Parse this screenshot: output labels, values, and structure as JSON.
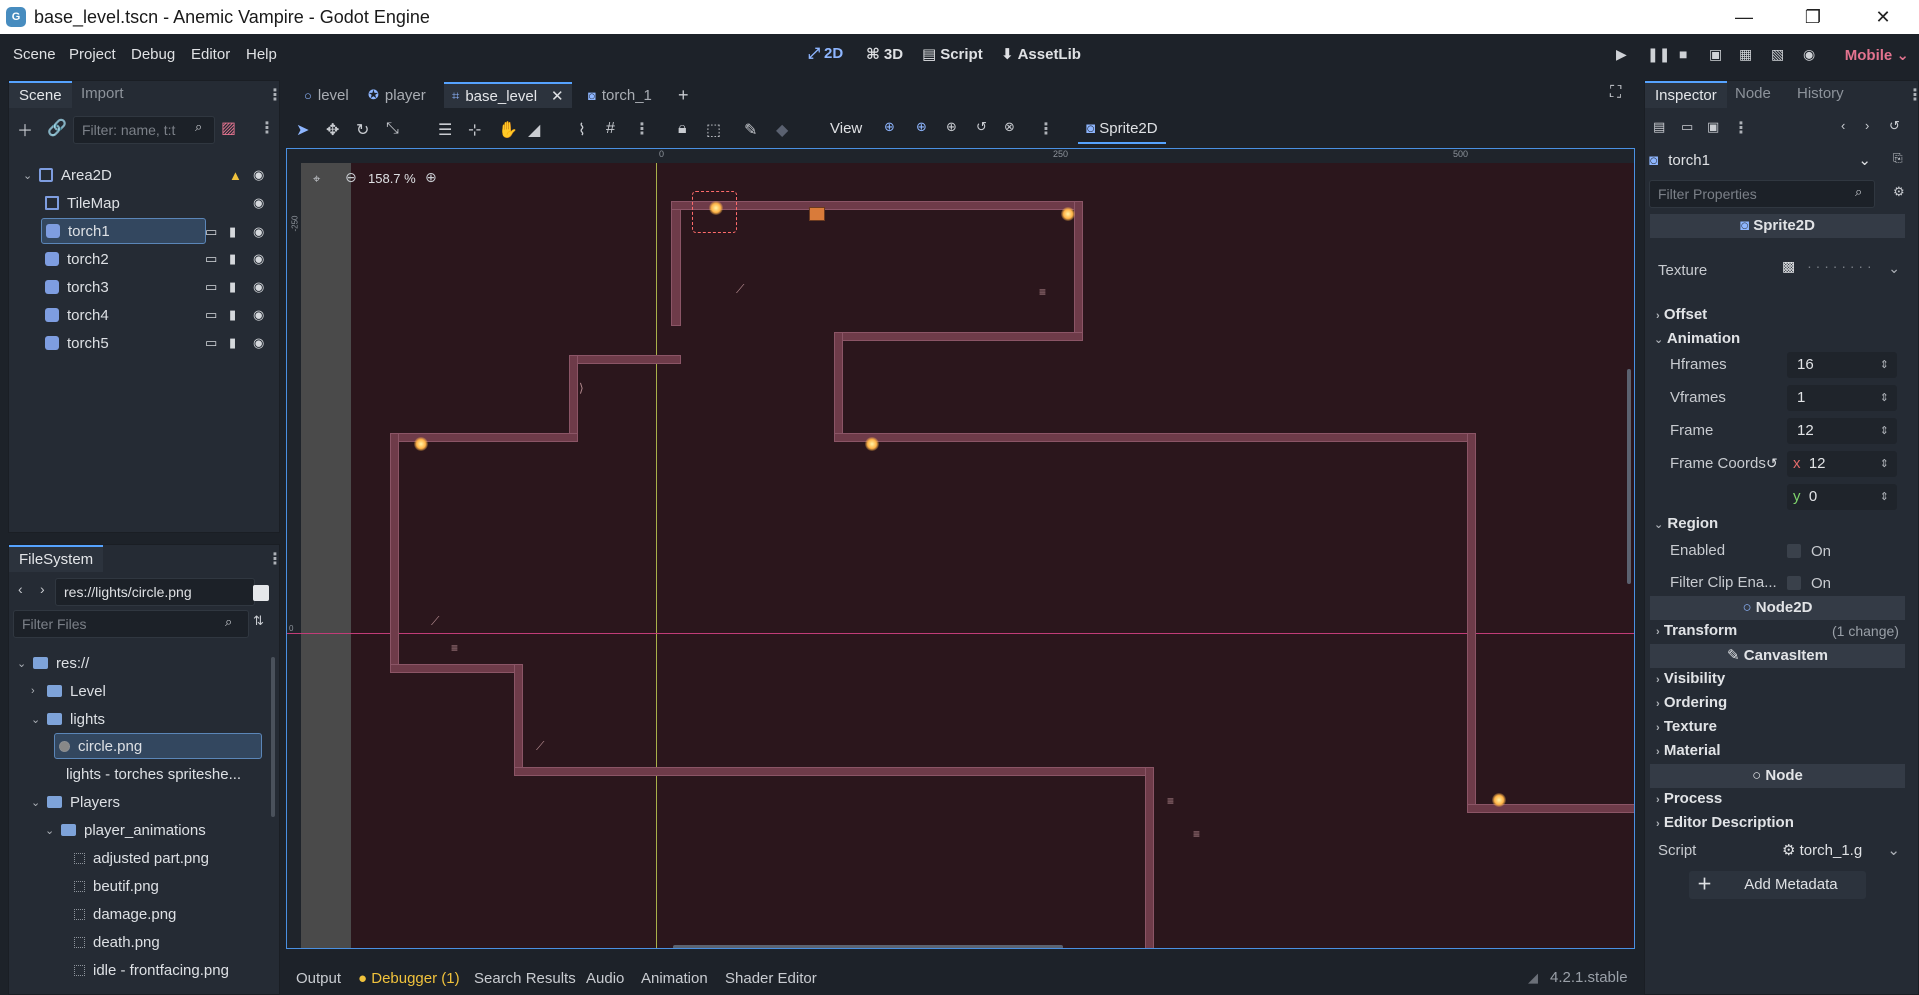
{
  "window": {
    "title": "base_level.tscn - Anemic Vampire - Godot Engine",
    "minimize": "—",
    "maximize": "❐",
    "close": "✕"
  },
  "menu": [
    "Scene",
    "Project",
    "Debug",
    "Editor",
    "Help"
  ],
  "workspaces": {
    "2d": "2D",
    "3d": "3D",
    "script": "Script",
    "assetlib": "AssetLib"
  },
  "renderer": "Mobile",
  "scene_dock": {
    "tabs": [
      "Scene",
      "Import"
    ],
    "filter_placeholder": "Filter: name, t:t",
    "nodes": [
      "Area2D",
      "TileMap",
      "torch1",
      "torch2",
      "torch3",
      "torch4",
      "torch5"
    ]
  },
  "filesystem": {
    "tab": "FileSystem",
    "path": "res://lights/circle.png",
    "filter_placeholder": "Filter Files",
    "items": [
      "res://",
      "Level",
      "lights",
      "circle.png",
      "lights - torches spriteshe...",
      "Players",
      "player_animations",
      "adjusted part.png",
      "beutif.png",
      "damage.png",
      "death.png",
      "idle - frontfacing.png"
    ]
  },
  "editor_tabs": [
    "level",
    "player",
    "base_level",
    "torch_1"
  ],
  "toolbar": {
    "view": "View",
    "sprite2d": "Sprite2D"
  },
  "viewport": {
    "zoom": "158.7 %",
    "ruler_x": [
      "0",
      "250",
      "500"
    ],
    "ruler_y": [
      "-250",
      "0"
    ]
  },
  "inspector": {
    "tabs": [
      "Inspector",
      "Node",
      "History"
    ],
    "node": "torch1",
    "filter_placeholder": "Filter Properties",
    "class_header": "Sprite2D",
    "texture_label": "Texture",
    "sections": {
      "offset": "Offset",
      "animation": "Animation",
      "region": "Region",
      "transform": "Transform",
      "visibility": "Visibility",
      "ordering": "Ordering",
      "texture": "Texture",
      "material": "Material",
      "process": "Process",
      "editor_description": "Editor Description"
    },
    "hframes_label": "Hframes",
    "hframes": "16",
    "vframes_label": "Vframes",
    "vframes": "1",
    "frame_label": "Frame",
    "frame": "12",
    "frame_coords_label": "Frame Coords",
    "frame_x": "12",
    "frame_y": "0",
    "x_label": "x",
    "y_label": "y",
    "enabled_label": "Enabled",
    "enabled_value": "On",
    "filter_clip_label": "Filter Clip Ena...",
    "filter_clip_value": "On",
    "node2d_header": "Node2D",
    "transform_change": "(1 change)",
    "canvasitem_header": "CanvasItem",
    "node_header": "Node",
    "script_label": "Script",
    "script_value": "torch_1.g",
    "add_metadata": "Add Metadata"
  },
  "bottom_panel": {
    "tabs": [
      "Output",
      "Debugger (1)",
      "Search Results",
      "Audio",
      "Animation",
      "Shader Editor"
    ],
    "version": "4.2.1.stable"
  },
  "colors": {
    "accent": "#8eb6ff",
    "warning": "#f0c23c",
    "mobile": "#e3738f",
    "selection": "#33475f"
  }
}
